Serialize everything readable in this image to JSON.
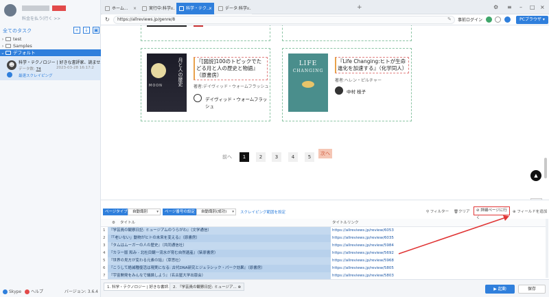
{
  "sidebar": {
    "subtext": "料金を払う(行く >>",
    "all_tasks": "全てのタスク",
    "tree": [
      {
        "label": "test"
      },
      {
        "label": "Samples"
      },
      {
        "label": "デフォルト"
      }
    ],
    "task": {
      "title": "科学・テクノロジー | 好きな書評家、読ませ...",
      "data_label": "データ数:",
      "data_count": "74",
      "date": "2023-03-28 16:17:2",
      "local_label": "最速スクレイピング"
    },
    "footer": {
      "skype": "Skype",
      "help": "ヘルプ",
      "version": "バージョン: 3.6.4"
    }
  },
  "tabs": [
    {
      "label": "ホーム..."
    },
    {
      "label": "実行中:科学..."
    },
    {
      "label": "科学・テク..."
    },
    {
      "label": "データ:科学..."
    }
  ],
  "tab_plus": "+",
  "address": {
    "url": "https://allreviews.jp/genre/8",
    "login": "事前ログイン",
    "pc_browser": "PCブラウザ"
  },
  "books": [
    {
      "title": "『[図説]100のトピックでたどる月と人の歴史と物語』（原書房）",
      "author": "著者:デイヴィッド・ウォームフラッシュ",
      "reviewer": "デイヴィッド・ウォームフラッシュ",
      "cover_text": "MOON",
      "cover_jp": "月と人の歴史"
    },
    {
      "title": "『Life Changing:ヒトが生命進化を加速する』（化学同人）",
      "author": "著者:ヘレン・ピルチャー",
      "reviewer": "中村 桂子",
      "cover_text": "LIFE",
      "cover_text2": "CHANGING"
    }
  ],
  "pager": {
    "prev": "前へ",
    "pages": [
      "1",
      "2",
      "3",
      "4",
      "5"
    ],
    "next": "次へ"
  },
  "scroll_top": "▲",
  "fold": "折る",
  "panel": {
    "page_type_label": "ページタイプ",
    "page_type_value": "自動識別",
    "page_num_label": "ページ番号の設定",
    "page_num_value": "自動識別(成功)",
    "scrape_range": "スクレイピング範囲を設定",
    "filter": "フィルター",
    "clear": "クリア",
    "detail_btn": "詳細ページに行く",
    "add_field": "フィールドを追加",
    "col_title": "タイトル",
    "col_link": "タイトルリンク",
    "rows": [
      {
        "n": "1",
        "title": "『学芸員の観察日記: ミュージアムのうらがわ』（文学通信）",
        "link": "https://allreviews.jp/review/6053"
      },
      {
        "n": "2",
        "title": "『「老いない」動物がヒトの未来を変える』（原書房）",
        "link": "https://allreviews.jp/review/6035"
      },
      {
        "n": "3",
        "title": "『タムはムーガーの人の歴史』（共同通信社）",
        "link": "https://allreviews.jp/review/5984"
      },
      {
        "n": "4",
        "title": "『カラー版 和み - 北杜目観一流水が育む自然遺産』（柴原書房）",
        "link": "https://allreviews.jp/review/5692"
      },
      {
        "n": "5",
        "title": "『世界の見方が変わる元素の話』（草思社）",
        "link": "https://allreviews.jp/review/5968"
      },
      {
        "n": "6",
        "title": "『こうして絶滅種復活は現実になる: 古代DNA研究とジュラシック・パーク効果』（原書房）",
        "link": "https://allreviews.jp/review/5805"
      },
      {
        "n": "7",
        "title": "『宇宙開発をみんなで議論しよう』（名古屋大学出版会）",
        "link": "https://allreviews.jp/review/5803"
      }
    ]
  },
  "bottom": {
    "tab1": "1. 科学・テクノロジー | 好きな書評...",
    "tab2": "2. 『学芸員の観察日記: ミュージア...",
    "start": "起動",
    "save": "保存"
  },
  "colors": {
    "accent": "#2f7fdc",
    "highlight": "#e03535"
  }
}
